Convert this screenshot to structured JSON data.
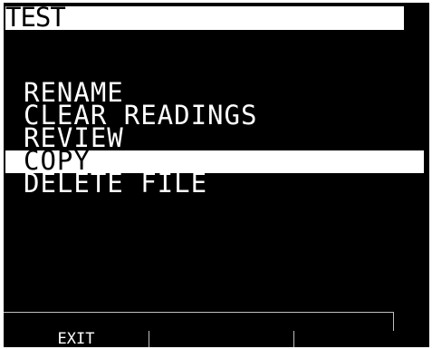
{
  "header": {
    "title": "TEST"
  },
  "menu": {
    "items": [
      {
        "label": "RENAME"
      },
      {
        "label": "CLEAR READINGS"
      },
      {
        "label": "REVIEW"
      },
      {
        "label": "COPY",
        "selected": true
      },
      {
        "label": "DELETE FILE"
      }
    ]
  },
  "softkeys": [
    {
      "label": "EXIT"
    },
    {
      "label": ""
    },
    {
      "label": ""
    }
  ],
  "colors": {
    "screen_bg": "#000000",
    "text": "#ffffff",
    "highlight": "#ffffff"
  }
}
